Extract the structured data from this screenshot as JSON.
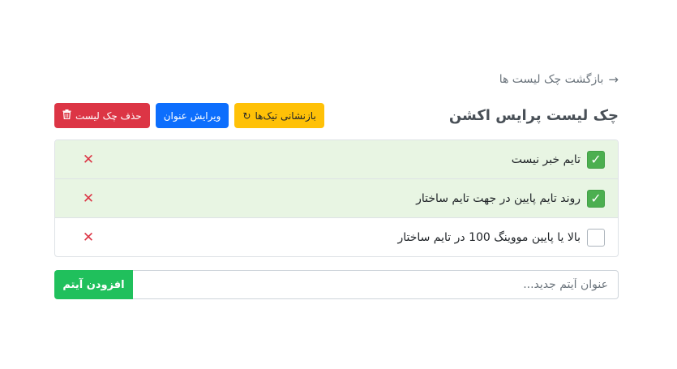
{
  "back_link": {
    "label": "بازگشت چک لیست ها",
    "icon": "arrow-right-icon"
  },
  "page": {
    "title": "چک لیست پرایس اکشن"
  },
  "actions": {
    "reset_label": "بازنشانی تیک‌ها",
    "reset_icon": "reset-icon",
    "edit_label": "ویرایش عنوان",
    "delete_label": "حذف چک لیست",
    "delete_icon": "trash-icon"
  },
  "items": [
    {
      "label": "تایم خبر نیست",
      "checked": true
    },
    {
      "label": "روند تایم پایین در جهت تایم ساختار",
      "checked": true
    },
    {
      "label": "بالا یا پایین مووینگ 100 در تایم ساختار",
      "checked": false
    }
  ],
  "add": {
    "placeholder": "عنوان آیتم جدید...",
    "value": "",
    "button_label": "افزودن آیتم"
  },
  "colors": {
    "done_row": "#e8f5e3",
    "check_on": "#4caf50",
    "warning": "#ffc107",
    "primary": "#0d6efd",
    "danger": "#dc3545",
    "success": "#20c05c"
  }
}
